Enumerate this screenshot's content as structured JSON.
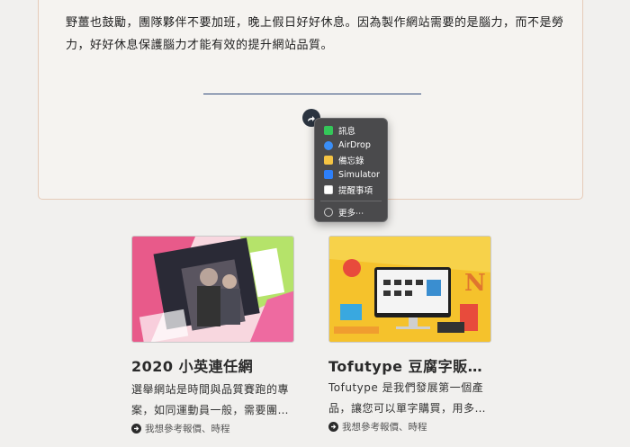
{
  "article": {
    "paragraph": "野薑也鼓勵，團隊夥伴不要加班，晚上假日好好休息。因為製作網站需要的是腦力，而不是勞力，好好休息保護腦力才能有效的提升網站品質。"
  },
  "share_menu": {
    "items": [
      {
        "label": "訊息",
        "icon": "messages-icon",
        "color": "#34c759"
      },
      {
        "label": "AirDrop",
        "icon": "airdrop-icon",
        "color": "#3a8ef6"
      },
      {
        "label": "備忘錄",
        "icon": "notes-icon",
        "color": "#f5c443"
      },
      {
        "label": "Simulator",
        "icon": "simulator-icon",
        "color": "#2d7ff9"
      },
      {
        "label": "提醒事項",
        "icon": "reminders-icon",
        "color": "#ffffff"
      }
    ],
    "more_label": "更多⋯"
  },
  "cards": [
    {
      "title": "2020 小英連任網",
      "desc": "選舉網站是時間與品質賽跑的專案，如同運動員一般，需要團…",
      "link": "我想參考報價、時程"
    },
    {
      "title": "Tofutype 豆腐字販…",
      "desc": "Tofutype 是我們發展第一個產品，讓您可以單字購買，用多…",
      "link": "我想參考報價、時程"
    }
  ]
}
